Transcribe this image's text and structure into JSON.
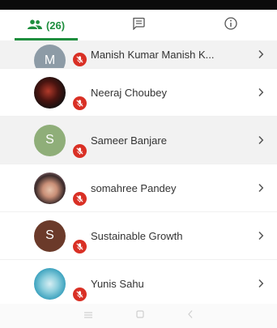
{
  "tabs": [
    {
      "name": "people",
      "count": "(26)"
    },
    {
      "name": "chat"
    },
    {
      "name": "info"
    }
  ],
  "participants": [
    {
      "initial": "M",
      "avatar_color": "#8d9ba6",
      "name": "Manish Kumar Manish K...",
      "mic": "muted",
      "highlighted": true
    },
    {
      "initial": "",
      "avatar_color": "#1c1c1c",
      "name": "Neeraj Choubey",
      "mic": "muted",
      "highlighted": false
    },
    {
      "initial": "S",
      "avatar_color": "#8fae79",
      "name": "Sameer Banjare",
      "mic": "muted",
      "highlighted": true
    },
    {
      "initial": "",
      "avatar_color": "#c9a38a",
      "name": "somahree Pandey",
      "mic": "muted",
      "highlighted": false
    },
    {
      "initial": "S",
      "avatar_color": "#6b3a2a",
      "name": "Sustainable Growth",
      "mic": "muted",
      "highlighted": false
    },
    {
      "initial": "",
      "avatar_color": "#7fc4d6",
      "name": "Yunis Sahu",
      "mic": "muted",
      "highlighted": false
    }
  ],
  "nav": [
    "menu",
    "home",
    "back"
  ],
  "colors": {
    "accent": "#1e8e3e",
    "mic_off": "#d93025"
  }
}
